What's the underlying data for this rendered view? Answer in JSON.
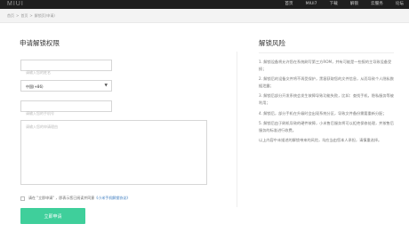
{
  "header": {
    "logo": "MIUI",
    "nav": [
      "首页",
      "MIUI7",
      "下载",
      "解锁",
      "云服务",
      "论坛"
    ]
  },
  "breadcrumb": {
    "items": [
      "首页",
      "首页",
      "解锁页(申请)"
    ]
  },
  "form": {
    "title": "申请解锁权限",
    "name_placeholder": "请输入您的姓名",
    "country_code": "中国(+86)",
    "phone_placeholder": "请输入您的手机号",
    "reason_placeholder": "请输入您的申请理由",
    "agree_prefix": "请在 \"立即申请\" ，即表示您已阅读并同意",
    "agree_link": "《小米手机解锁协议》",
    "submit_label": "立即申请"
  },
  "risks": {
    "title": "解锁风险",
    "items": [
      "1. 解锁设备将允许您在系统刷写第三方ROM，并有可能是一些报的主导致设备受损；",
      "2. 解锁后的设备文件将不再受保护，黑客获取您的文件信息，从而导致个人隐私数据泄露；",
      "3. 解锁后部分开发系统会发生故障导致功能失败，比如：查找手机，隐私服务等被利用；",
      "4. 解锁后，部分手机在升级时会出现系统分区，导致文件备份需要重新分配；",
      "5. 解锁后由于刷机导致的硬件故障，小米售后服务将可以拒绝保修处理，并按售后服务的标准进行收费。",
      "以上内容中未描述的解锁带来的风险，均应当由您本人承担，请慎重选择。"
    ]
  }
}
